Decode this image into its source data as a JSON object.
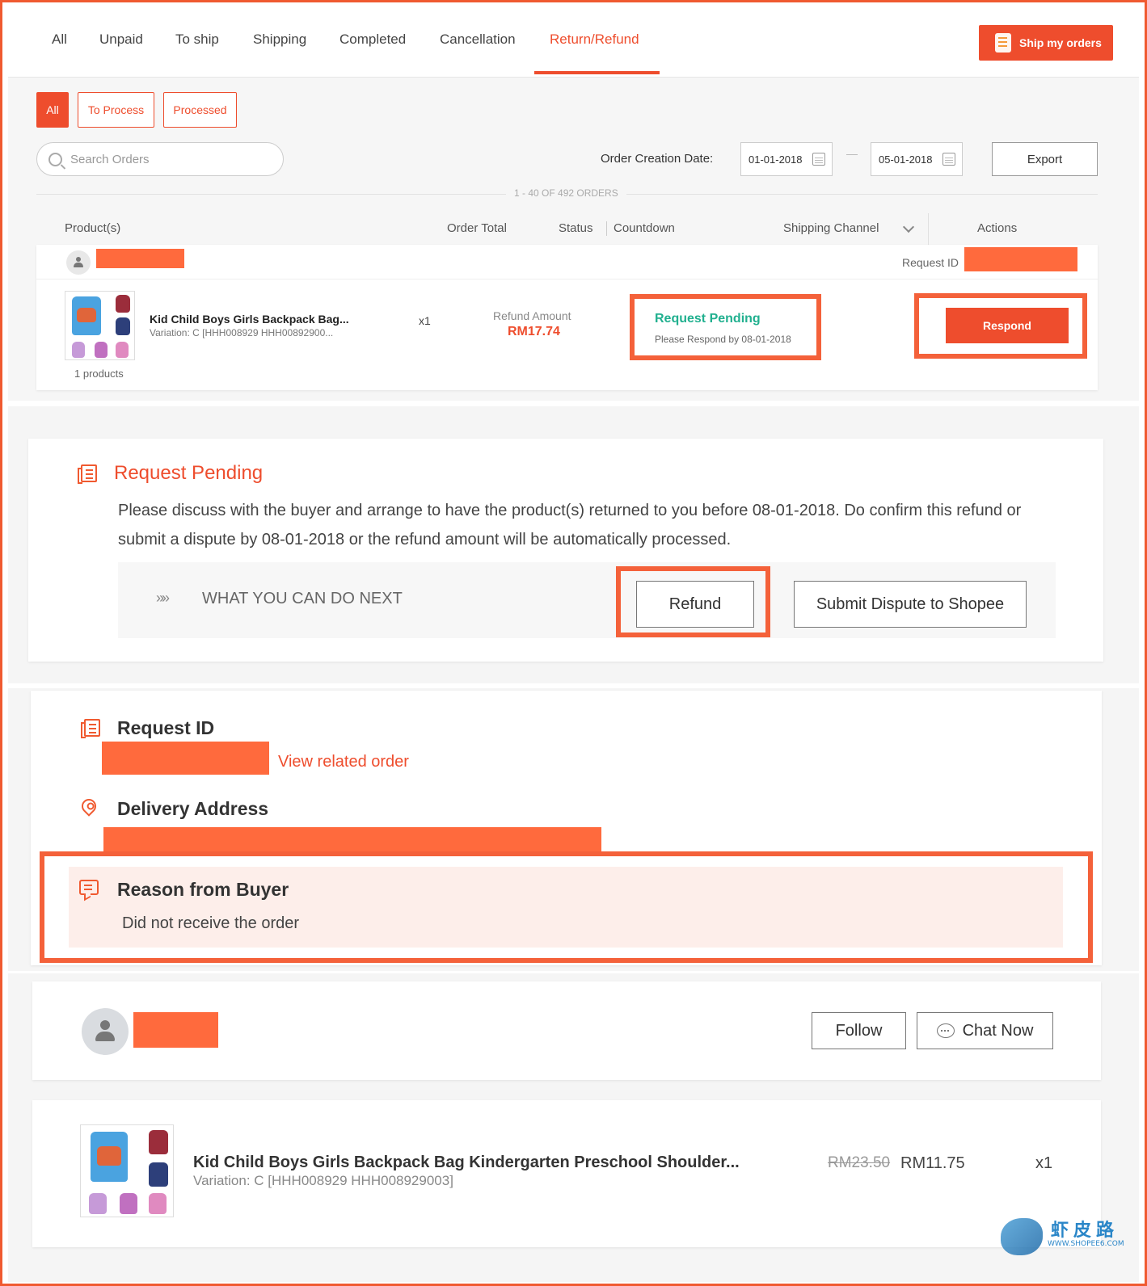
{
  "nav": {
    "tabs": [
      "All",
      "Unpaid",
      "To ship",
      "Shipping",
      "Completed",
      "Cancellation",
      "Return/Refund"
    ],
    "active_tab": "Return/Refund",
    "ship_button": "Ship my orders"
  },
  "filters": {
    "chips": [
      "All",
      "To Process",
      "Processed"
    ],
    "active_chip": "All",
    "search_placeholder": "Search Orders",
    "date_label": "Order Creation Date:",
    "date_from": "01-01-2018",
    "date_to": "05-01-2018",
    "export_label": "Export",
    "count_text": "1 - 40 OF 492 ORDERS"
  },
  "table": {
    "headers": {
      "products": "Product(s)",
      "order_total": "Order Total",
      "status": "Status",
      "countdown": "Countdown",
      "shipping_channel": "Shipping Channel",
      "actions": "Actions"
    },
    "order": {
      "request_id_label": "Request ID",
      "product_name": "Kid Child Boys Girls Backpack Bag...",
      "variation": "Variation: C [HHH008929 HHH00892900...",
      "product_count": "1 products",
      "quantity": "x1",
      "refund_label": "Refund Amount",
      "refund_amount": "RM17.74",
      "status": "Request Pending",
      "status_sub": "Please Respond by 08-01-2018",
      "action": "Respond"
    }
  },
  "pending": {
    "title": "Request Pending",
    "body": "Please discuss with the buyer and arrange to have the product(s) returned to you before 08-01-2018. Do confirm this refund or submit a dispute by 08-01-2018 or the refund amount will be automatically processed.",
    "next_arrows": "»»",
    "next_label": "WHAT YOU CAN DO NEXT",
    "refund_button": "Refund",
    "dispute_button": "Submit Dispute to Shopee"
  },
  "details": {
    "request_id_title": "Request ID",
    "view_order_link": "View related order",
    "delivery_title": "Delivery Address",
    "reason_title": "Reason from Buyer",
    "reason_text": "Did not receive the order"
  },
  "buyer": {
    "follow": "Follow",
    "chat": "Chat Now"
  },
  "product": {
    "name": "Kid Child Boys Girls Backpack Bag Kindergarten Preschool Shoulder...",
    "variation": "Variation: C [HHH008929 HHH008929003]",
    "price_original": "RM23.50",
    "price": "RM11.75",
    "quantity": "x1"
  },
  "watermark": {
    "cn": "虾皮路",
    "url": "WWW.SHOPEE6.COM"
  },
  "colors": {
    "accent": "#ee4d2d",
    "highlight": "#f4613a",
    "redaction": "#ff6a3d",
    "status_green": "#21b08f"
  }
}
